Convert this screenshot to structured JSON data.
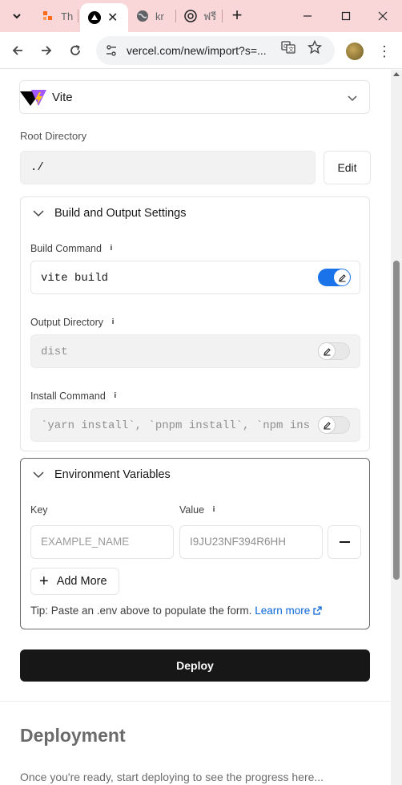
{
  "browser": {
    "tabs": [
      {
        "title": "Th",
        "icon": "orange-tab-icon"
      },
      {
        "title": "",
        "icon": "vercel-triangle-icon",
        "active": true
      },
      {
        "title": "kr",
        "icon": "globe-icon"
      },
      {
        "title": "ฟรี",
        "icon": "openai-icon"
      }
    ],
    "url": "vercel.com/new/import?s=..."
  },
  "framework": {
    "name": "Vite"
  },
  "root_directory": {
    "label": "Root Directory",
    "value": "./",
    "edit_label": "Edit"
  },
  "build_settings": {
    "title": "Build and Output Settings",
    "build_command": {
      "label": "Build Command",
      "value": "vite build",
      "override": true
    },
    "output_directory": {
      "label": "Output Directory",
      "value": "dist",
      "override": false
    },
    "install_command": {
      "label": "Install Command",
      "value": "`yarn install`, `pnpm install`, `npm ins",
      "override": false
    }
  },
  "env_vars": {
    "title": "Environment Variables",
    "key_label": "Key",
    "value_label": "Value",
    "key_placeholder": "EXAMPLE_NAME",
    "value_placeholder": "I9JU23NF394R6HH",
    "add_more_label": "Add More",
    "tip_text": "Tip: Paste an .env above to populate the form.",
    "learn_more": "Learn more"
  },
  "deploy_label": "Deploy",
  "deployment": {
    "title": "Deployment",
    "subtitle": "Once you're ready, start deploying to see the progress here..."
  }
}
